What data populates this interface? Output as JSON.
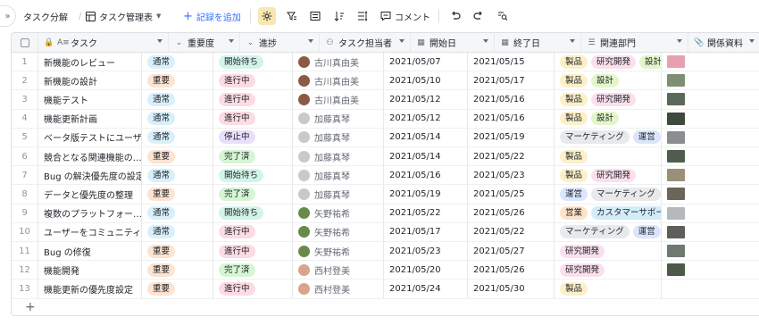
{
  "toolbar": {
    "expand_icon": "double-chevron-right-icon",
    "breadcrumb_root": "タスク分解",
    "breadcrumb_sep": "/",
    "view_icon": "table-icon",
    "view_name": "タスク管理表",
    "add_record_label": "記録を追加",
    "comment_label": "コメント"
  },
  "columns": [
    {
      "label": "タスク",
      "icon": "text-icon"
    },
    {
      "label": "重要度",
      "icon": "select-icon"
    },
    {
      "label": "進捗",
      "icon": "select-icon"
    },
    {
      "label": "タスク担当者",
      "icon": "person-icon"
    },
    {
      "label": "開始日",
      "icon": "calendar-icon"
    },
    {
      "label": "終了日",
      "icon": "calendar-icon"
    },
    {
      "label": "関連部門",
      "icon": "multiselect-icon"
    },
    {
      "label": "関係資料",
      "icon": "attachment-icon"
    }
  ],
  "colors": {
    "priority": {
      "通常": "#d9f0fb",
      "重要": "#fde3d1"
    },
    "progress": {
      "開始待ち": "#d3f5e9",
      "進行中": "#fddbe2",
      "停止中": "#e8dffc",
      "完了済": "#d6f5d3"
    },
    "dept": {
      "製品": "#fbf0c8",
      "研究開発": "#fbe0ec",
      "設計": "#e2f6c9",
      "マーケティング": "#e8e9eb",
      "運営": "#dbe6fd",
      "営業": "#fde3c8",
      "カスタマーサポート": "#d3ecf9"
    },
    "avatar": {
      "古川真由美": "#8b5a44",
      "加藤真琴": "#c9c9c9",
      "矢野祐希": "#6a8a4c",
      "西村登美": "#d9a48c"
    },
    "thumbs": [
      "#e8a0b0",
      "#7d8f72",
      "#5a6a58",
      "#3e4a3c",
      "#8a8e90",
      "#4f5d4e",
      "#9c8f7a",
      "#6a6658",
      "#b5b9bc",
      "#5d5f58",
      "#6e7a70",
      "#4c5a48"
    ]
  },
  "rows": [
    {
      "idx": "1",
      "task": "新機能のレビュー",
      "priority": "通常",
      "progress": "開始待ち",
      "owner": "古川真由美",
      "start": "2021/05/07",
      "end": "2021/05/15",
      "dept": [
        "製品",
        "研究開発",
        "設計"
      ],
      "attachments": 1
    },
    {
      "idx": "2",
      "task": "新機能の設計",
      "priority": "重要",
      "progress": "進行中",
      "owner": "古川真由美",
      "start": "2021/05/10",
      "end": "2021/05/17",
      "dept": [
        "製品",
        "設計"
      ],
      "attachments": 1
    },
    {
      "idx": "3",
      "task": "機能テスト",
      "priority": "通常",
      "progress": "進行中",
      "owner": "古川真由美",
      "start": "2021/05/12",
      "end": "2021/05/16",
      "dept": [
        "製品",
        "研究開発"
      ],
      "attachments": 1
    },
    {
      "idx": "4",
      "task": "機能更新計画",
      "priority": "通常",
      "progress": "進行中",
      "owner": "加藤真琴",
      "start": "2021/05/12",
      "end": "2021/05/16",
      "dept": [
        "製品",
        "設計"
      ],
      "attachments": 1
    },
    {
      "idx": "5",
      "task": "ベータ版テストにユーザ…",
      "priority": "通常",
      "progress": "停止中",
      "owner": "加藤真琴",
      "start": "2021/05/14",
      "end": "2021/05/19",
      "dept": [
        "マーケティング",
        "運営"
      ],
      "attachments": 1
    },
    {
      "idx": "6",
      "task": "競合となる関連機能の…",
      "priority": "重要",
      "progress": "完了済",
      "owner": "加藤真琴",
      "start": "2021/05/14",
      "end": "2021/05/22",
      "dept": [
        "製品"
      ],
      "attachments": 1
    },
    {
      "idx": "7",
      "task": "Bug の解決優先度の設定",
      "priority": "通常",
      "progress": "開始待ち",
      "owner": "加藤真琴",
      "start": "2021/05/16",
      "end": "2021/05/23",
      "dept": [
        "製品",
        "研究開発"
      ],
      "attachments": 1
    },
    {
      "idx": "8",
      "task": "データと優先度の整理",
      "priority": "重要",
      "progress": "完了済",
      "owner": "加藤真琴",
      "start": "2021/05/19",
      "end": "2021/05/25",
      "dept": [
        "運営",
        "マーケティング"
      ],
      "attachments": 1
    },
    {
      "idx": "9",
      "task": "複数のプラットフォー…",
      "priority": "通常",
      "progress": "開始待ち",
      "owner": "矢野祐希",
      "start": "2021/05/22",
      "end": "2021/05/26",
      "dept": [
        "営業",
        "カスタマーサポー"
      ],
      "attachments": 1
    },
    {
      "idx": "10",
      "task": "ユーザーをコミュニティ…",
      "priority": "通常",
      "progress": "進行中",
      "owner": "矢野祐希",
      "start": "2021/05/17",
      "end": "2021/05/22",
      "dept": [
        "マーケティング",
        "運営"
      ],
      "attachments": 1
    },
    {
      "idx": "11",
      "task": "Bug の修復",
      "priority": "重要",
      "progress": "進行中",
      "owner": "矢野祐希",
      "start": "2021/05/23",
      "end": "2021/05/27",
      "dept": [
        "研究開発"
      ],
      "attachments": 1
    },
    {
      "idx": "12",
      "task": "機能開発",
      "priority": "重要",
      "progress": "完了済",
      "owner": "西村登美",
      "start": "2021/05/20",
      "end": "2021/05/26",
      "dept": [
        "研究開発"
      ],
      "attachments": 1
    },
    {
      "idx": "13",
      "task": "機能更新の優先度設定",
      "priority": "重要",
      "progress": "進行中",
      "owner": "西村登美",
      "start": "2021/05/24",
      "end": "2021/05/30",
      "dept": [
        "製品"
      ],
      "attachments": 0
    }
  ],
  "add_row_label": "+"
}
